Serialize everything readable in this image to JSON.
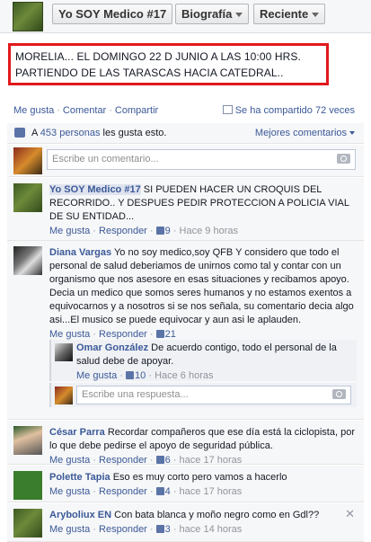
{
  "header": {
    "page_name_button": "Yo SOY Medico #17",
    "bio_button": "Biografía",
    "recent_button": "Reciente"
  },
  "post": {
    "text_line1": "MORELIA... EL DOMINGO 22 D JUNIO A LAS 10:00 HRS.",
    "text_line2": "PARTIENDO DE LAS TARASCAS HACIA CATEDRAL.."
  },
  "actions": {
    "like": "Me gusta",
    "comment": "Comentar",
    "share": "Compartir",
    "shared_count": "Se ha compartido 72 veces"
  },
  "likes": {
    "prefix": "A",
    "link": "453 personas",
    "suffix": "les gusta esto.",
    "best_comments": "Mejores comentarios"
  },
  "compose": {
    "placeholder": "Escribe un comentario..."
  },
  "comments": [
    {
      "author": "Yo SOY Medico #17",
      "text": "SI PUEDEN HACER UN CROQUIS DEL RECORRIDO.. Y DESPUES PEDIR PROTECCION A POLICIA VIAL DE SU ENTIDAD...",
      "like": "Me gusta",
      "reply": "Responder",
      "likes": "9",
      "time": "Hace 9 horas"
    },
    {
      "author": "Diana Vargas",
      "text": "Yo no soy medico,soy QFB Y considero que todo el personal de salud deberiamos de unirnos como tal y contar con un organismo que nos asesore en esas situaciones y recibamos apoyo. Decia un medico que somos seres humanos y no estamos exentos a equivocarnos y a nosotros si se nos señala, su comentario decia algo asi...El musico se puede equivocar y aun asi le aplauden.",
      "like": "Me gusta",
      "reply": "Responder",
      "likes": "21",
      "time": ""
    },
    {
      "author": "César Parra",
      "text": "Recordar compañeros que ese día está la ciclopista, por lo que debe pedirse el apoyo de seguridad pública.",
      "like": "Me gusta",
      "reply": "Responder",
      "likes": "6",
      "time": "hace 17 horas"
    },
    {
      "author": "Polette Tapia",
      "text": "Eso es muy corto pero vamos a hacerlo",
      "like": "Me gusta",
      "reply": "Responder",
      "likes": "4",
      "time": "hace 17 horas"
    },
    {
      "author": "Aryboliux EN",
      "text": "Con bata blanca y moño negro como en Gdl??",
      "like": "Me gusta",
      "reply": "Responder",
      "likes": "3",
      "time": "hace 14 horas"
    }
  ],
  "reply": {
    "author": "Omar González",
    "text": "De acuerdo contigo, todo el personal de la salud debe de apoyar.",
    "like": "Me gusta",
    "likes": "10",
    "time": "Hace 6 horas"
  },
  "reply_box": {
    "placeholder": "Escribe una respuesta..."
  },
  "colors": {
    "link": "#3b5998",
    "highlight_border": "#e1191c",
    "ufi_bg": "#f6f7f8"
  }
}
